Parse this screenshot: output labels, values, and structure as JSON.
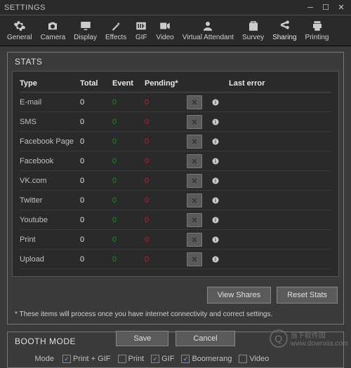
{
  "window": {
    "title": "SETTINGS"
  },
  "toolbar": {
    "items": [
      {
        "label": "General"
      },
      {
        "label": "Camera"
      },
      {
        "label": "Display"
      },
      {
        "label": "Effects"
      },
      {
        "label": "GIF"
      },
      {
        "label": "Video"
      },
      {
        "label": "Virtual Attendant"
      },
      {
        "label": "Survey"
      },
      {
        "label": "Sharing"
      },
      {
        "label": "Printing"
      }
    ]
  },
  "stats": {
    "title": "STATS",
    "headers": {
      "type": "Type",
      "total": "Total",
      "event": "Event",
      "pending": "Pending*",
      "lasterror": "Last error"
    },
    "rows": [
      {
        "type": "E-mail",
        "total": "0",
        "event": "0",
        "pending": "0"
      },
      {
        "type": "SMS",
        "total": "0",
        "event": "0",
        "pending": "0"
      },
      {
        "type": "Facebook Page",
        "total": "0",
        "event": "0",
        "pending": "0"
      },
      {
        "type": "Facebook",
        "total": "0",
        "event": "0",
        "pending": "0"
      },
      {
        "type": "VK.com",
        "total": "0",
        "event": "0",
        "pending": "0"
      },
      {
        "type": "Twitter",
        "total": "0",
        "event": "0",
        "pending": "0"
      },
      {
        "type": "Youtube",
        "total": "0",
        "event": "0",
        "pending": "0"
      },
      {
        "type": "Print",
        "total": "0",
        "event": "0",
        "pending": "0"
      },
      {
        "type": "Upload",
        "total": "0",
        "event": "0",
        "pending": "0"
      }
    ],
    "view_shares": "View Shares",
    "reset_stats": "Reset Stats",
    "note": "* These items will process once you have internet connectivity and correct settings."
  },
  "booth": {
    "title": "BOOTH MODE",
    "mode_label": "Mode",
    "options": [
      {
        "label": "Print + GIF",
        "checked": true
      },
      {
        "label": "Print",
        "checked": false
      },
      {
        "label": "GIF",
        "checked": true
      },
      {
        "label": "Boomerang",
        "checked": true
      },
      {
        "label": "Video",
        "checked": false
      }
    ]
  },
  "footer": {
    "save": "Save",
    "cancel": "Cancel"
  },
  "watermark": {
    "text1": "当下软件园",
    "text2": "www.downxia.com"
  }
}
